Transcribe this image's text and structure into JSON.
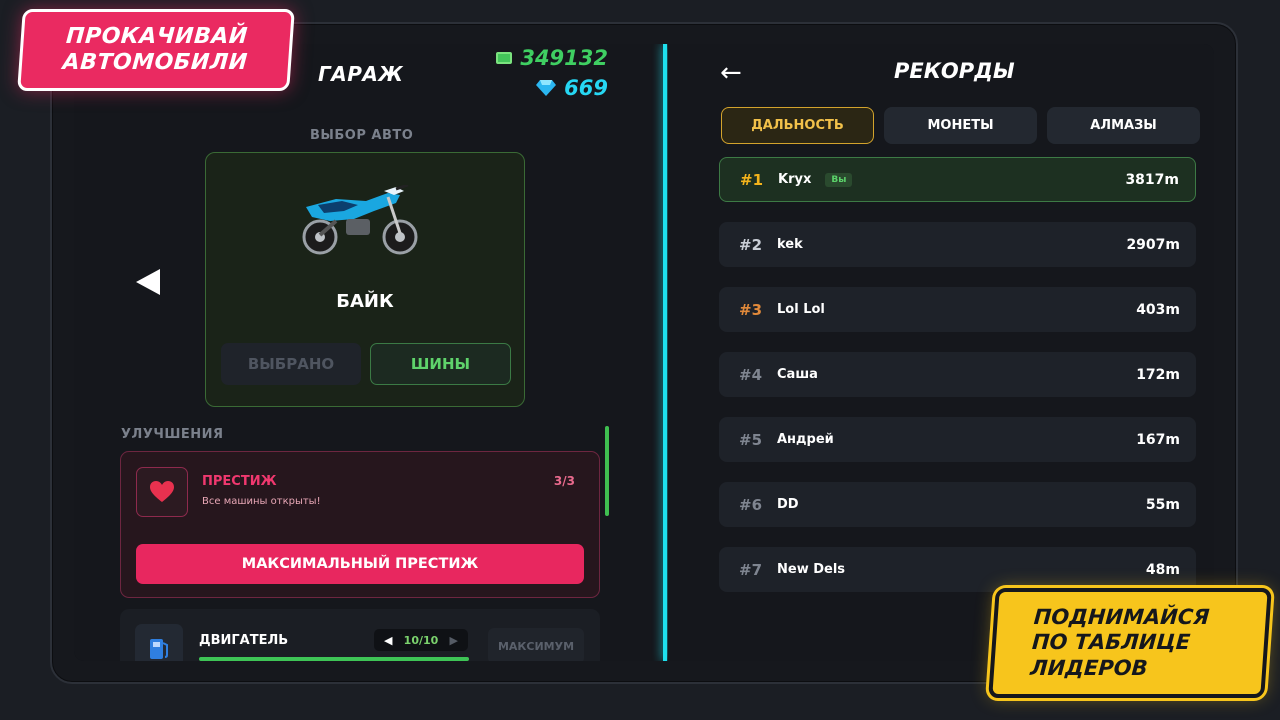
{
  "promo": {
    "top_line1": "ПРОКАЧИВАЙ",
    "top_line2": "АВТОМОБИЛИ",
    "bottom_line1": "ПОДНИМАЙСЯ",
    "bottom_line2": "ПО ТАБЛИЦЕ",
    "bottom_line3": "ЛИДЕРОВ"
  },
  "garage": {
    "title": "ГАРАЖ",
    "cash": "349132",
    "gems": "669",
    "select_label": "ВЫБОР АВТО",
    "vehicle_name": "БАЙК",
    "selected_label": "ВЫБРАНО",
    "tires_label": "ШИНЫ",
    "upgrades_label": "УЛУЧШЕНИЯ",
    "prestige": {
      "title": "ПРЕСТИЖ",
      "count": "3/3",
      "description": "Все машины открыты!",
      "button": "МАКСИМАЛЬНЫЙ ПРЕСТИЖ"
    },
    "engine": {
      "title": "ДВИГАТЕЛЬ",
      "level": "10/10",
      "level_fraction": 1.0,
      "max_label": "МАКСИМУМ"
    }
  },
  "records": {
    "title": "РЕКОРДЫ",
    "back_symbol": "←",
    "tabs": [
      {
        "label": "ДАЛЬНОСТЬ",
        "active": true
      },
      {
        "label": "МОНЕТЫ",
        "active": false
      },
      {
        "label": "АЛМАЗЫ",
        "active": false
      }
    ],
    "you_badge": "Вы",
    "rows": [
      {
        "rank": "#1",
        "name": "Kryx",
        "distance": "3817m"
      },
      {
        "rank": "#2",
        "name": "kek",
        "distance": "2907m"
      },
      {
        "rank": "#3",
        "name": "Lol Lol",
        "distance": "403m"
      },
      {
        "rank": "#4",
        "name": "Саша",
        "distance": "172m"
      },
      {
        "rank": "#5",
        "name": "Андрей",
        "distance": "167m"
      },
      {
        "rank": "#6",
        "name": "DD",
        "distance": "55m"
      },
      {
        "rank": "#7",
        "name": "New Dels",
        "distance": "48m"
      }
    ]
  },
  "colors": {
    "accent_cyan": "#1ee0ee",
    "prestige_pink": "#e8275f",
    "promo_yellow": "#f7c51c",
    "cash_green": "#3fcf62",
    "gem_blue": "#26d7f3"
  }
}
